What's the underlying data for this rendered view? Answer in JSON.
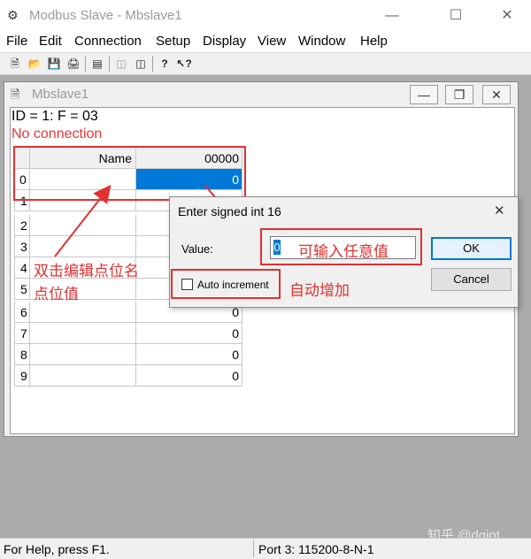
{
  "window": {
    "title": "Modbus Slave - Mbslave1"
  },
  "menu": [
    "File",
    "Edit",
    "Connection",
    "Setup",
    "Display",
    "View",
    "Window",
    "Help"
  ],
  "toolbar_icons": [
    "new-icon",
    "open-icon",
    "save-icon",
    "print-icon",
    "window-icon",
    "connect-icon",
    "disconnect-icon",
    "help-icon",
    "context-help-icon"
  ],
  "child": {
    "title": "Mbslave1",
    "id_line": "ID = 1: F = 03",
    "connection_status": "No connection"
  },
  "grid": {
    "name_header": "Name",
    "address_header": "00000",
    "rows": [
      {
        "index": "0",
        "value": "0"
      },
      {
        "index": "1",
        "value": ""
      },
      {
        "index": "2",
        "value": ""
      },
      {
        "index": "3",
        "value": ""
      },
      {
        "index": "4",
        "value": ""
      },
      {
        "index": "5",
        "value": ""
      },
      {
        "index": "6",
        "value": "0"
      },
      {
        "index": "7",
        "value": "0"
      },
      {
        "index": "8",
        "value": "0"
      },
      {
        "index": "9",
        "value": "0"
      }
    ]
  },
  "dialog": {
    "title": "Enter signed int 16",
    "value_label": "Value:",
    "value": "0",
    "auto_increment_label": "Auto increment",
    "ok_label": "OK",
    "cancel_label": "Cancel"
  },
  "annotations": {
    "double_click_line1": "双击编辑点位名",
    "double_click_line2": "点位值",
    "any_value": "可输入任意值",
    "auto_increase": "自动增加"
  },
  "statusbar": {
    "help_text": "For Help, press F1.",
    "port_text": "Port 3: 115200-8-N-1"
  },
  "watermark": "知乎 @dgiot",
  "colors": {
    "annotation_red": "#e23030",
    "selection_blue": "#0078d7"
  }
}
